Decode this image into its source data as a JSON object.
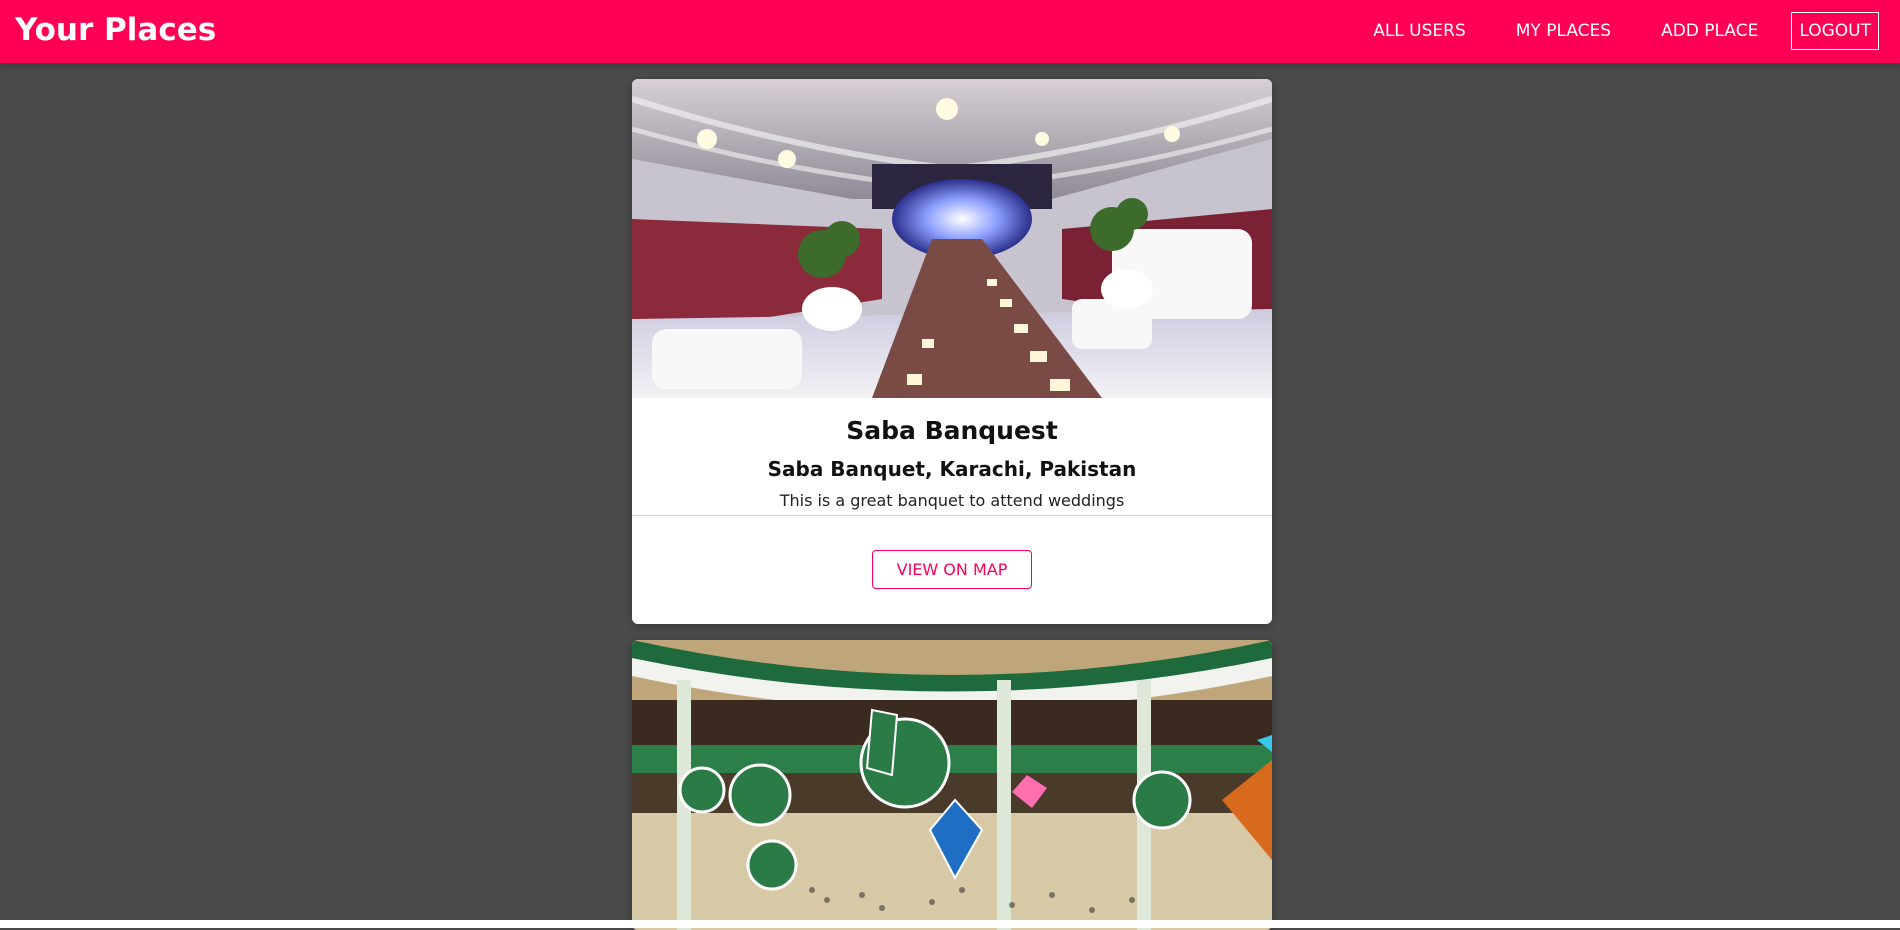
{
  "app": {
    "brand": "Your Places",
    "accent_color": "#ff0055",
    "nav": [
      {
        "label": "ALL USERS"
      },
      {
        "label": "MY PLACES"
      },
      {
        "label": "ADD PLACE"
      },
      {
        "label": "LOGOUT"
      }
    ]
  },
  "places": [
    {
      "title": "Saba Banquest",
      "address": "Saba Banquet, Karachi, Pakistan",
      "description": "This is a great banquet to attend weddings",
      "button_label": "VIEW ON MAP",
      "image_subject": "banquet hall interior"
    },
    {
      "image_subject": "shopping mall interior with green decorations"
    }
  ]
}
